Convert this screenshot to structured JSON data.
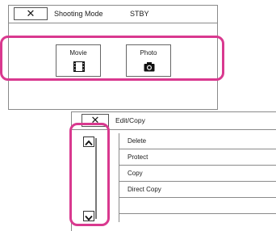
{
  "shooting_mode": {
    "close_label": "✕",
    "title": "Shooting Mode",
    "status": "STBY",
    "buttons": [
      {
        "label": "Movie",
        "icon": "film-icon"
      },
      {
        "label": "Photo",
        "icon": "camera-icon"
      }
    ]
  },
  "edit_copy": {
    "close_label": "✕",
    "title": "Edit/Copy",
    "items": [
      {
        "label": "Delete"
      },
      {
        "label": "Protect"
      },
      {
        "label": "Copy"
      },
      {
        "label": "Direct Copy"
      }
    ],
    "scroll_up_icon": "chevron-up-icon",
    "scroll_down_icon": "chevron-down-icon"
  },
  "highlight_color": "#d9398f"
}
